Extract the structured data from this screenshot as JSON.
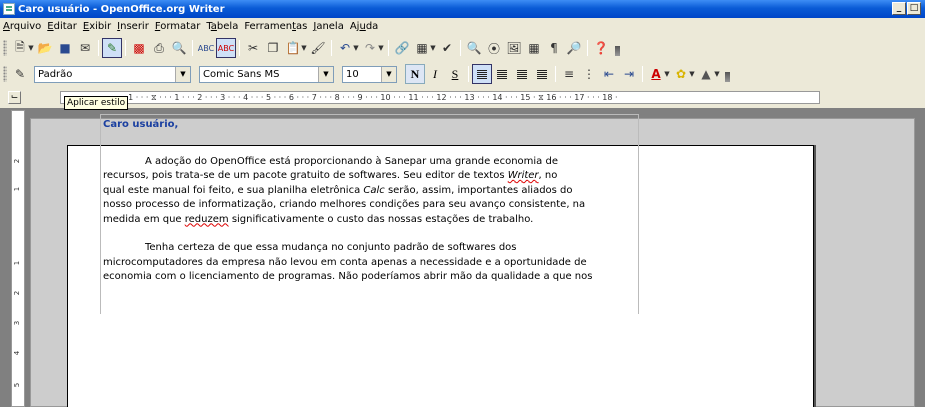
{
  "window": {
    "title": "Caro usuário - OpenOffice.org Writer",
    "controls": [
      "_",
      "□",
      "×"
    ]
  },
  "menu": [
    {
      "pre": "",
      "acc": "A",
      "post": "rquivo"
    },
    {
      "pre": "",
      "acc": "E",
      "post": "ditar"
    },
    {
      "pre": "",
      "acc": "E",
      "post": "xibir"
    },
    {
      "pre": "",
      "acc": "I",
      "post": "nserir"
    },
    {
      "pre": "",
      "acc": "F",
      "post": "ormatar"
    },
    {
      "pre": "T",
      "acc": "a",
      "post": "bela"
    },
    {
      "pre": "Ferramen",
      "acc": "t",
      "post": "as"
    },
    {
      "pre": "",
      "acc": "J",
      "post": "anela"
    },
    {
      "pre": "Aj",
      "acc": "u",
      "post": "da"
    }
  ],
  "format": {
    "style_value": "Padrão",
    "font_value": "Comic Sans MS",
    "size_value": "10",
    "bold_label": "N",
    "italic_label": "I",
    "underline_label": "S"
  },
  "ruler": {
    "text": "· 1 · · · ⧖ · · · 1 · · · 2 · · · 3 · · · 4 · · · 5 · · · 6 · · · 7 · · · 8 · · · 9 · · · 10 · · · 11 · · · 12 · · · 13 · · · 14 · · · 15 · ⧖ 16 · · · 17 · · · 18 ·"
  },
  "tooltip": "Aplicar estilo",
  "vruler_numbers": [
    "2",
    "1",
    "1",
    "2",
    "3",
    "4",
    "5"
  ],
  "document": {
    "salutation": "Caro usuário,",
    "p1": {
      "l1": "A adoção do OpenOffice está proporcionando à Sanepar uma grande economia de",
      "l2a": "recursos, pois trata-se de um pacote gratuito de softwares. Seu editor de textos ",
      "l2b": "Writer",
      "l2c": ", no",
      "l3a": "qual este manual foi feito, e sua planilha eletrônica ",
      "l3b": "Calc",
      "l3c": " serão, assim, importantes aliados do",
      "l4": "nosso processo de informatização, criando melhores condições para seu avanço consistente, na",
      "l5a": "medida em que ",
      "l5b": "reduzem",
      "l5c": " significativamente o custo das nossas estações de trabalho."
    },
    "p2": {
      "l1": "Tenha certeza de que essa mudança no conjunto padrão de softwares dos",
      "l2": "microcomputadores da empresa não levou em conta apenas a necessidade e a oportunidade de",
      "l3": "economia com o licenciamento de programas. Não poderíamos abrir mão da qualidade a que nos"
    }
  },
  "colors": {
    "titlebar": "#0a5bd6",
    "salutation": "#1a3fa0",
    "workspace": "#808080"
  }
}
